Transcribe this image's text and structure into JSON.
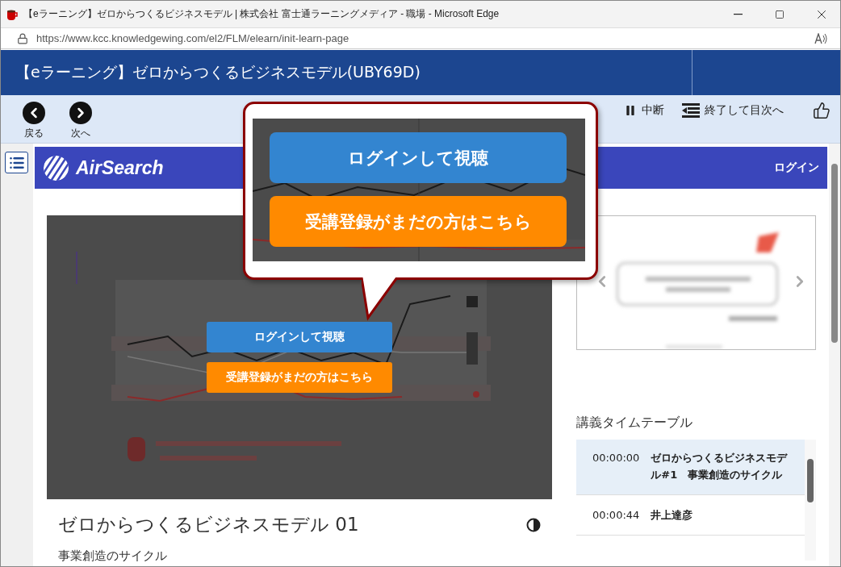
{
  "window": {
    "title": "【eラーニング】ゼロからつくるビジネスモデル | 株式会社 富士通ラーニングメディア - 職場 - Microsoft Edge"
  },
  "address_bar": {
    "url": "https://www.kcc.knowledgewing.com/el2/FLM/elearn/init-learn-page"
  },
  "course_header": {
    "title": "【eラーニング】ゼロからつくるビジネスモデル(UBY69D)"
  },
  "toolbar": {
    "nav": [
      {
        "kind": "back",
        "label": "戻る"
      },
      {
        "kind": "next",
        "label": "次へ"
      }
    ],
    "actions": [
      {
        "kind": "pause",
        "label": "中断"
      },
      {
        "kind": "exit",
        "label": "終了して目次へ"
      }
    ]
  },
  "site_header": {
    "brand": "AirSearch",
    "login": "ログイン"
  },
  "video": {
    "buttons": [
      {
        "kind": "login",
        "label": "ログインして視聴"
      },
      {
        "kind": "register",
        "label": "受講登録がまだの方はこちら"
      }
    ]
  },
  "lecture": {
    "title": "ゼロからつくるビジネスモデル 01",
    "subtitle": "事業創造のサイクル"
  },
  "timetable": {
    "title": "講義タイムテーブル",
    "rows": [
      {
        "time": "00:00:00",
        "title": "ゼロからつくるビジネスモデル#1　事業創造のサイクル",
        "selected": true
      },
      {
        "time": "00:00:44",
        "title": "井上達彦",
        "selected": false
      }
    ]
  },
  "callout": {
    "buttons": [
      {
        "kind": "login",
        "label": "ログインして視聴"
      },
      {
        "kind": "register",
        "label": "受講登録がまだの方はこちら"
      }
    ]
  }
}
